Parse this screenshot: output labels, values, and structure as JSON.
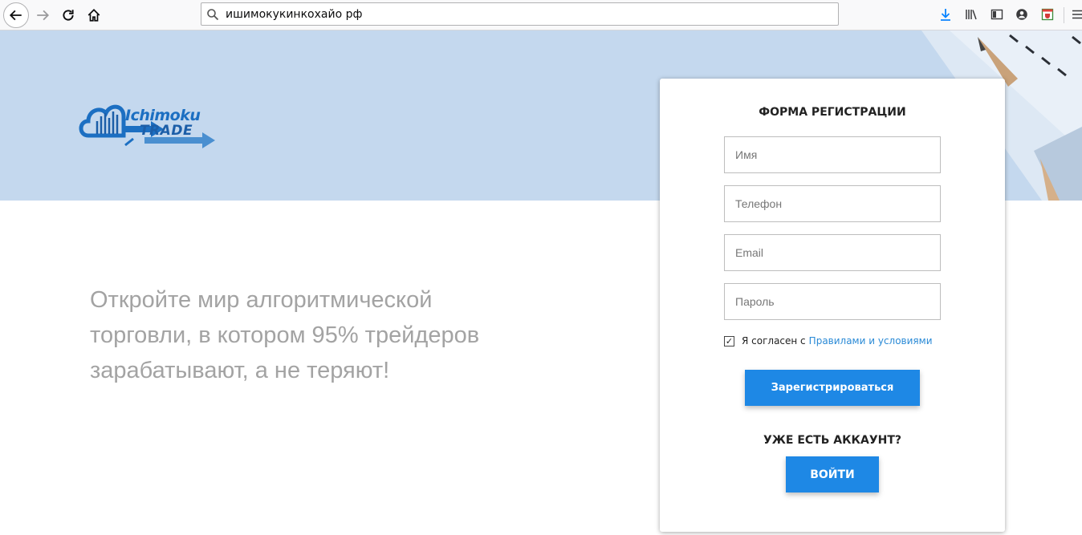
{
  "browser": {
    "url": "ишимокукинкохайо рф",
    "icons": [
      "back-icon",
      "forward-icon",
      "reload-icon",
      "home-icon",
      "search-icon",
      "download-icon",
      "library-icon",
      "sidebar-icon",
      "account-icon",
      "extension-icon",
      "menu-icon"
    ]
  },
  "logo": {
    "line1": "Ichimoku",
    "line2": "TRADE"
  },
  "hero": {
    "tagline": "Откройте мир алгоритмической торговли, в котором 95% трейдеров зарабатывают, а не теряют!"
  },
  "form": {
    "title": "ФОРМА РЕГИСТРАЦИИ",
    "name_placeholder": "Имя",
    "phone_placeholder": "Телефон",
    "email_placeholder": "Email",
    "password_placeholder": "Пароль",
    "agree_text": "Я согласен с",
    "agree_link": "Правилами и условиями",
    "agree_checked": "✓",
    "register_label": "Зарегистрироваться",
    "have_account": "УЖЕ ЕСТЬ АККАУНТ?",
    "login_label": "ВОЙТИ"
  },
  "colors": {
    "accent": "#1e88e5",
    "hero_bg": "#c4d8ee",
    "link": "#2a8ad6",
    "tagline": "#a3a3a3"
  }
}
